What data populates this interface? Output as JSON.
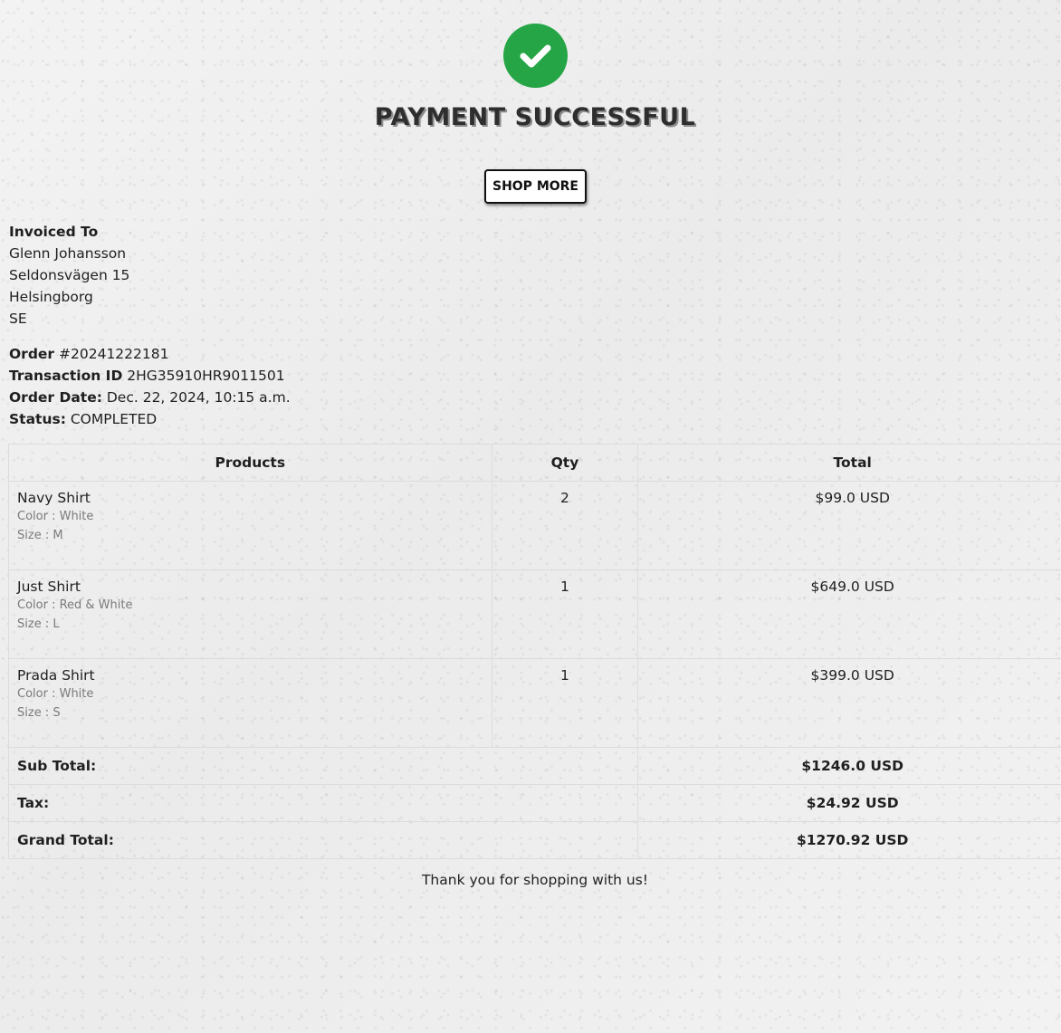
{
  "hero": {
    "icon": "check-circle-icon",
    "title": "PAYMENT SUCCESSFUL",
    "shop_more_label": "SHOP MORE",
    "accent_color": "#25a546"
  },
  "invoice": {
    "heading": "Invoiced To",
    "name": "Glenn Johansson",
    "street": "Seldonsvägen 15",
    "city": "Helsingborg",
    "country": "SE"
  },
  "order": {
    "order_label": "Order",
    "order_number": "#20241222181",
    "transaction_label": "Transaction ID",
    "transaction_id": "2HG35910HR9011501",
    "date_label": "Order Date:",
    "date_value": "Dec. 22, 2024, 10:15 a.m.",
    "status_label": "Status:",
    "status_value": "COMPLETED"
  },
  "table": {
    "headers": {
      "products": "Products",
      "qty": "Qty",
      "total": "Total"
    },
    "items": [
      {
        "name": "Navy Shirt",
        "color": "Color : White",
        "size": "Size : M",
        "qty": "2",
        "total": "$99.0 USD"
      },
      {
        "name": "Just Shirt",
        "color": "Color : Red & White",
        "size": "Size : L",
        "qty": "1",
        "total": "$649.0 USD"
      },
      {
        "name": "Prada Shirt",
        "color": "Color : White",
        "size": "Size : S",
        "qty": "1",
        "total": "$399.0 USD"
      }
    ],
    "summary": {
      "subtotal_label": "Sub Total:",
      "subtotal_value": "$1246.0 USD",
      "tax_label": "Tax:",
      "tax_value": "$24.92 USD",
      "grand_total_label": "Grand Total:",
      "grand_total_value": "$1270.92 USD"
    }
  },
  "footer": {
    "thanks": "Thank you for shopping with us!"
  }
}
